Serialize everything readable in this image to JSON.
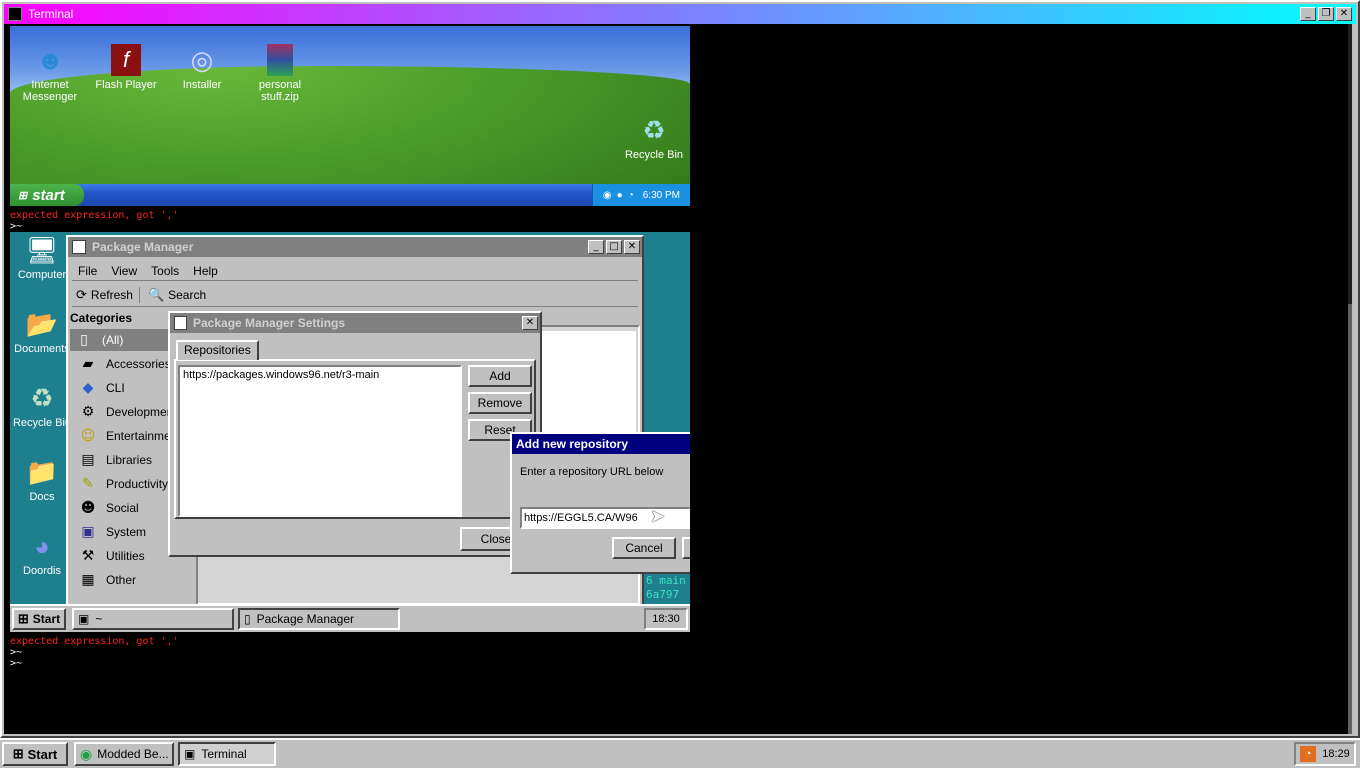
{
  "terminal_window": {
    "title": "Terminal",
    "controls": {
      "minimize": "_",
      "maximize": "❐",
      "close": "✕"
    },
    "errors": [
      "expected expression, got ','",
      "expected expression, got ','"
    ],
    "prompts": [
      ">~",
      ">~",
      ">~"
    ]
  },
  "xp_screenshot": {
    "icons": [
      {
        "label": "Internet Messenger"
      },
      {
        "label": "Flash Player"
      },
      {
        "label": "Installer"
      },
      {
        "label": "personal stuff.zip"
      },
      {
        "label": "Recycle Bin"
      }
    ],
    "start_label": "start",
    "clock": "6:30 PM"
  },
  "w96_screenshot": {
    "desktop_icons": [
      {
        "label": "Computer"
      },
      {
        "label": "Documents"
      },
      {
        "label": "Recycle Bin"
      },
      {
        "label": "Docs"
      },
      {
        "label": "Doordis"
      }
    ],
    "taskbar": {
      "start_label": "Start",
      "tasks": [
        {
          "label": "~"
        },
        {
          "label": "Package Manager"
        }
      ],
      "clock": "18:30"
    },
    "teal_text": [
      "6 main",
      "6a797"
    ]
  },
  "package_manager": {
    "title": "Package Manager",
    "menu": [
      "File",
      "View",
      "Tools",
      "Help"
    ],
    "toolbar": {
      "refresh": "Refresh",
      "search": "Search"
    },
    "categories_title": "Categories",
    "categories": [
      {
        "label": "(All)",
        "icon": "package-icon"
      },
      {
        "label": "Accessories",
        "icon": "folder-icon"
      },
      {
        "label": "CLI",
        "icon": "diamond-icon"
      },
      {
        "label": "Development",
        "icon": "gears-icon"
      },
      {
        "label": "Entertainment",
        "icon": "smiley-icon"
      },
      {
        "label": "Libraries",
        "icon": "book-icon"
      },
      {
        "label": "Productivity",
        "icon": "note-icon"
      },
      {
        "label": "Social",
        "icon": "people-icon"
      },
      {
        "label": "System",
        "icon": "monitor-icon"
      },
      {
        "label": "Utilities",
        "icon": "tools-icon"
      },
      {
        "label": "Other",
        "icon": "box-icon"
      }
    ]
  },
  "settings_dialog": {
    "title": "Package Manager Settings",
    "tab": "Repositories",
    "repositories": [
      "https://packages.windows96.net/r3-main"
    ],
    "buttons": {
      "add": "Add",
      "remove": "Remove",
      "reset": "Reset",
      "close": "Close"
    }
  },
  "add_repo_dialog": {
    "title": "Add new repository",
    "prompt": "Enter a repository URL below",
    "input_value": "https://EGGL5.CA/W96",
    "cancel": "Cancel"
  },
  "host_taskbar": {
    "start_label": "Start",
    "tasks": [
      {
        "label": "Modded Be..."
      },
      {
        "label": "Terminal"
      }
    ],
    "clock": "18:29"
  },
  "colors": {
    "terminal_title_gradient": [
      "#ff00ff",
      "#00ffff"
    ],
    "error_text": "#ff2020",
    "w96_desktop": "#1e7f8f",
    "active_title": "#000080",
    "inactive_title": "#808080"
  }
}
